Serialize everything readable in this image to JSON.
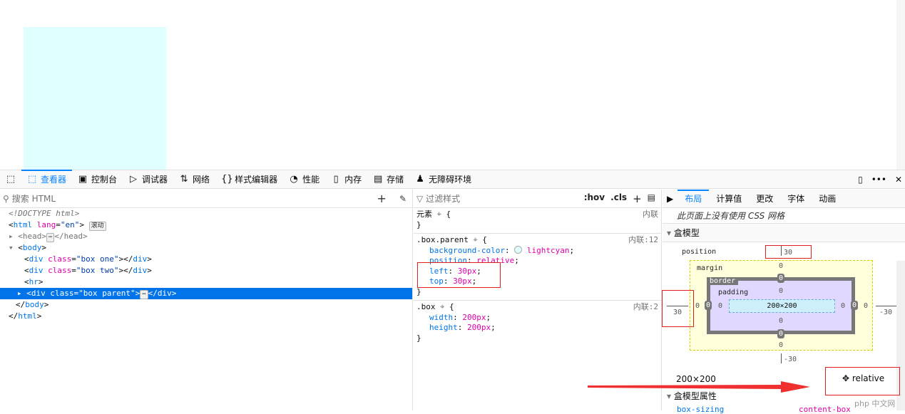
{
  "toolbar": {
    "tabs": [
      {
        "label": "查看器",
        "icon": "inspector-icon",
        "selected": true
      },
      {
        "label": "控制台",
        "icon": "console-icon"
      },
      {
        "label": "调试器",
        "icon": "debugger-icon"
      },
      {
        "label": "网络",
        "icon": "network-icon"
      },
      {
        "label": "样式编辑器",
        "icon": "style-editor-icon"
      },
      {
        "label": "性能",
        "icon": "performance-icon"
      },
      {
        "label": "内存",
        "icon": "memory-icon"
      },
      {
        "label": "存储",
        "icon": "storage-icon"
      },
      {
        "label": "无障碍环境",
        "icon": "accessibility-icon"
      }
    ]
  },
  "markup": {
    "search_placeholder": "搜索 HTML",
    "scroll_badge": "滚动",
    "doctype": "<!DOCTYPE html>",
    "html_tag": "html",
    "lang_attr": "lang",
    "lang_val": "\"en\"",
    "head": "<head>",
    "head_close": "</head>",
    "body": "body",
    "div": "div",
    "class_attr": "class",
    "one": "\"box one\"",
    "two": "\"box two\"",
    "hr": "hr",
    "parent": "\"box parent\""
  },
  "rules": {
    "filter_placeholder": "过滤样式",
    "hov": ":hov",
    "cls": ".cls",
    "element_selector": "元素",
    "inline": "内联",
    "parent_selector": ".box.parent",
    "parent_src": "内联:12",
    "parent_props": [
      [
        "background-color",
        "lightcyan"
      ],
      [
        "position",
        "relative"
      ],
      [
        "left",
        "30px"
      ],
      [
        "top",
        "30px"
      ]
    ],
    "box_selector": ".box",
    "box_src": "内联:2",
    "box_props": [
      [
        "width",
        "200px"
      ],
      [
        "height",
        "200px"
      ]
    ],
    "swatch_color": "#e0ffff"
  },
  "layout": {
    "tabs": [
      "布局",
      "计算值",
      "更改",
      "字体",
      "动画"
    ],
    "no_grid": "此页面上没有使用 CSS 网格",
    "boxmodel_title": "盒模型",
    "position_label": "position",
    "margin_label": "margin",
    "border_label": "border",
    "padding_label": "padding",
    "pos_top": "30",
    "pos_left": "30",
    "pos_right": "-30",
    "pos_bottom": "-30",
    "zero": "0",
    "content_size": "200×200",
    "size": "200×200",
    "position_value": "relative",
    "props_title": "盒模型属性",
    "box_sizing": "box-sizing",
    "box_sizing_value": "content-box"
  },
  "watermark": "php 中文网"
}
